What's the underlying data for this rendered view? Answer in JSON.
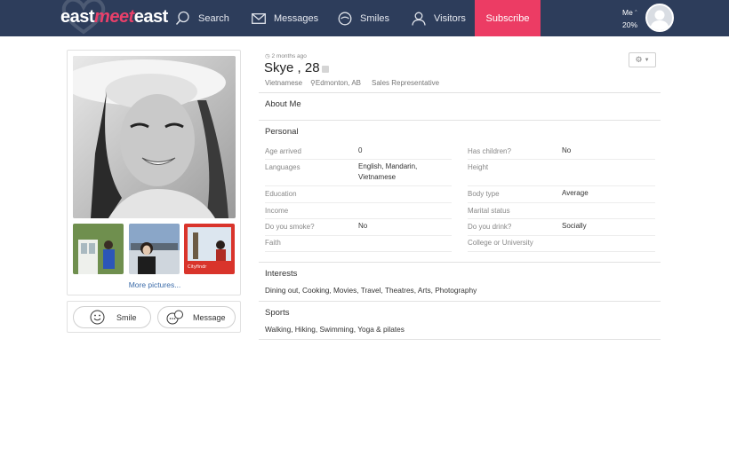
{
  "nav": {
    "logo": {
      "part1": "east",
      "part2": "meet",
      "part3": "east"
    },
    "items": [
      {
        "label": "Search",
        "icon": "search-icon"
      },
      {
        "label": "Messages",
        "icon": "envelope-icon"
      },
      {
        "label": "Smiles",
        "icon": "smile-icon"
      },
      {
        "label": "Visitors",
        "icon": "user-icon"
      }
    ],
    "subscribe": "Subscribe",
    "me_label": "Me",
    "me_percent": "20%"
  },
  "profile": {
    "last_seen": "2 months ago",
    "name": "Skye , 28",
    "ethnicity": "Vietnamese",
    "location": "Edmonton, AB",
    "occupation": "Sales Representative",
    "gear_menu": "gear-icon"
  },
  "photos": {
    "more": "More pictures...",
    "thumb3_caption": "Cityfindr"
  },
  "actions": {
    "smile": "Smile",
    "message": "Message"
  },
  "about": {
    "title": "About Me"
  },
  "personal": {
    "title": "Personal",
    "left": [
      {
        "label": "Age arrived",
        "value": "0"
      },
      {
        "label": "Languages",
        "value": "English, Mandarin, Vietnamese"
      },
      {
        "label": "Education",
        "value": ""
      },
      {
        "label": "Income",
        "value": ""
      },
      {
        "label": "Do you smoke?",
        "value": "No"
      },
      {
        "label": "Faith",
        "value": ""
      }
    ],
    "right": [
      {
        "label": "Has children?",
        "value": "No"
      },
      {
        "label": "Height",
        "value": ""
      },
      {
        "label": "Body type",
        "value": "Average"
      },
      {
        "label": "Marital status",
        "value": ""
      },
      {
        "label": "Do you drink?",
        "value": "Socially"
      },
      {
        "label": "College or University",
        "value": ""
      }
    ]
  },
  "interests": {
    "title": "Interests",
    "text": "Dining out, Cooking, Movies, Travel, Theatres, Arts, Photography"
  },
  "sports": {
    "title": "Sports",
    "text": "Walking, Hiking, Swimming, Yoga & pilates"
  },
  "colors": {
    "nav_bg": "#2d3d5b",
    "accent": "#ec3c64",
    "link": "#3a6aa8"
  }
}
